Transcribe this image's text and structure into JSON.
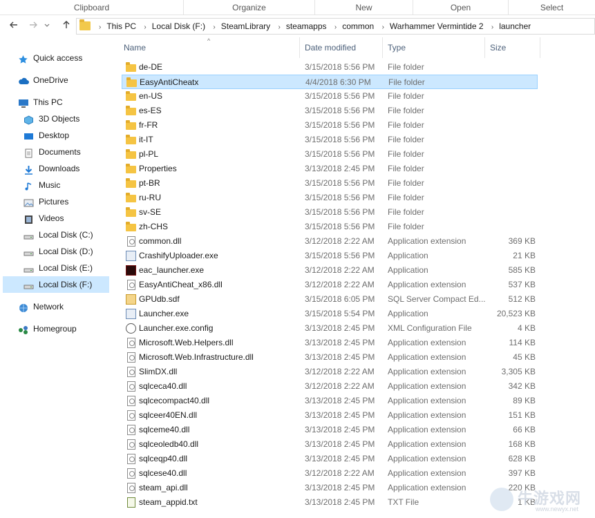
{
  "ribbon": {
    "groups": [
      "Clipboard",
      "Organize",
      "New",
      "Open",
      "Select"
    ]
  },
  "address": {
    "crumbs": [
      "This PC",
      "Local Disk (F:)",
      "SteamLibrary",
      "steamapps",
      "common",
      "Warhammer Vermintide 2",
      "launcher"
    ]
  },
  "nav": {
    "back_icon": "back-arrow-icon",
    "forward_icon": "forward-arrow-icon",
    "recent_icon": "chevron-down-icon",
    "up_icon": "up-arrow-icon"
  },
  "sidebar": {
    "items": [
      {
        "label": "Quick access",
        "icon": "star-icon"
      },
      {
        "label": "OneDrive",
        "icon": "cloud-icon"
      },
      {
        "label": "This PC",
        "icon": "computer-icon"
      },
      {
        "label": "3D Objects",
        "icon": "cube-icon"
      },
      {
        "label": "Desktop",
        "icon": "desktop-icon"
      },
      {
        "label": "Documents",
        "icon": "document-icon"
      },
      {
        "label": "Downloads",
        "icon": "download-icon"
      },
      {
        "label": "Music",
        "icon": "music-icon"
      },
      {
        "label": "Pictures",
        "icon": "picture-icon"
      },
      {
        "label": "Videos",
        "icon": "video-icon"
      },
      {
        "label": "Local Disk (C:)",
        "icon": "drive-icon"
      },
      {
        "label": "Local Disk (D:)",
        "icon": "drive-icon"
      },
      {
        "label": "Local Disk (E:)",
        "icon": "drive-icon"
      },
      {
        "label": "Local Disk (F:)",
        "icon": "drive-icon"
      },
      {
        "label": "Network",
        "icon": "network-icon"
      },
      {
        "label": "Homegroup",
        "icon": "homegroup-icon"
      }
    ],
    "selected": "Local Disk (F:)"
  },
  "columns": {
    "name": "Name",
    "date": "Date modified",
    "type": "Type",
    "size": "Size",
    "sort_indicator": "^"
  },
  "files": [
    {
      "name": "de-DE",
      "date": "3/15/2018 5:56 PM",
      "type": "File folder",
      "size": "",
      "icon": "folder"
    },
    {
      "name": "EasyAntiCheatx",
      "date": "4/4/2018 6:30 PM",
      "type": "File folder",
      "size": "",
      "icon": "folder"
    },
    {
      "name": "en-US",
      "date": "3/15/2018 5:56 PM",
      "type": "File folder",
      "size": "",
      "icon": "folder"
    },
    {
      "name": "es-ES",
      "date": "3/15/2018 5:56 PM",
      "type": "File folder",
      "size": "",
      "icon": "folder"
    },
    {
      "name": "fr-FR",
      "date": "3/15/2018 5:56 PM",
      "type": "File folder",
      "size": "",
      "icon": "folder"
    },
    {
      "name": "it-IT",
      "date": "3/15/2018 5:56 PM",
      "type": "File folder",
      "size": "",
      "icon": "folder"
    },
    {
      "name": "pl-PL",
      "date": "3/15/2018 5:56 PM",
      "type": "File folder",
      "size": "",
      "icon": "folder"
    },
    {
      "name": "Properties",
      "date": "3/13/2018 2:45 PM",
      "type": "File folder",
      "size": "",
      "icon": "folder"
    },
    {
      "name": "pt-BR",
      "date": "3/15/2018 5:56 PM",
      "type": "File folder",
      "size": "",
      "icon": "folder"
    },
    {
      "name": "ru-RU",
      "date": "3/15/2018 5:56 PM",
      "type": "File folder",
      "size": "",
      "icon": "folder"
    },
    {
      "name": "sv-SE",
      "date": "3/15/2018 5:56 PM",
      "type": "File folder",
      "size": "",
      "icon": "folder"
    },
    {
      "name": "zh-CHS",
      "date": "3/15/2018 5:56 PM",
      "type": "File folder",
      "size": "",
      "icon": "folder"
    },
    {
      "name": "common.dll",
      "date": "3/12/2018 2:22 AM",
      "type": "Application extension",
      "size": "369 KB",
      "icon": "dll"
    },
    {
      "name": "CrashifyUploader.exe",
      "date": "3/15/2018 5:56 PM",
      "type": "Application",
      "size": "21 KB",
      "icon": "exe"
    },
    {
      "name": "eac_launcher.exe",
      "date": "3/12/2018 2:22 AM",
      "type": "Application",
      "size": "585 KB",
      "icon": "eac"
    },
    {
      "name": "EasyAntiCheat_x86.dll",
      "date": "3/12/2018 2:22 AM",
      "type": "Application extension",
      "size": "537 KB",
      "icon": "dll"
    },
    {
      "name": "GPUdb.sdf",
      "date": "3/15/2018 6:05 PM",
      "type": "SQL Server Compact Ed...",
      "size": "512 KB",
      "icon": "sdf"
    },
    {
      "name": "Launcher.exe",
      "date": "3/15/2018 5:54 PM",
      "type": "Application",
      "size": "20,523 KB",
      "icon": "exe"
    },
    {
      "name": "Launcher.exe.config",
      "date": "3/13/2018 2:45 PM",
      "type": "XML Configuration File",
      "size": "4 KB",
      "icon": "cfg"
    },
    {
      "name": "Microsoft.Web.Helpers.dll",
      "date": "3/13/2018 2:45 PM",
      "type": "Application extension",
      "size": "114 KB",
      "icon": "dll"
    },
    {
      "name": "Microsoft.Web.Infrastructure.dll",
      "date": "3/13/2018 2:45 PM",
      "type": "Application extension",
      "size": "45 KB",
      "icon": "dll"
    },
    {
      "name": "SlimDX.dll",
      "date": "3/12/2018 2:22 AM",
      "type": "Application extension",
      "size": "3,305 KB",
      "icon": "dll"
    },
    {
      "name": "sqlceca40.dll",
      "date": "3/12/2018 2:22 AM",
      "type": "Application extension",
      "size": "342 KB",
      "icon": "dll"
    },
    {
      "name": "sqlcecompact40.dll",
      "date": "3/13/2018 2:45 PM",
      "type": "Application extension",
      "size": "89 KB",
      "icon": "dll"
    },
    {
      "name": "sqlceer40EN.dll",
      "date": "3/13/2018 2:45 PM",
      "type": "Application extension",
      "size": "151 KB",
      "icon": "dll"
    },
    {
      "name": "sqlceme40.dll",
      "date": "3/13/2018 2:45 PM",
      "type": "Application extension",
      "size": "66 KB",
      "icon": "dll"
    },
    {
      "name": "sqlceoledb40.dll",
      "date": "3/13/2018 2:45 PM",
      "type": "Application extension",
      "size": "168 KB",
      "icon": "dll"
    },
    {
      "name": "sqlceqp40.dll",
      "date": "3/13/2018 2:45 PM",
      "type": "Application extension",
      "size": "628 KB",
      "icon": "dll"
    },
    {
      "name": "sqlcese40.dll",
      "date": "3/12/2018 2:22 AM",
      "type": "Application extension",
      "size": "397 KB",
      "icon": "dll"
    },
    {
      "name": "steam_api.dll",
      "date": "3/13/2018 2:45 PM",
      "type": "Application extension",
      "size": "220 KB",
      "icon": "dll"
    },
    {
      "name": "steam_appid.txt",
      "date": "3/13/2018 2:45 PM",
      "type": "TXT File",
      "size": "1 KB",
      "icon": "txt"
    }
  ],
  "selected_file": "EasyAntiCheatx",
  "watermark": {
    "text": "牛游戏网",
    "url": "www.newyx.net"
  },
  "colors": {
    "selection_bg": "#cce8ff",
    "selection_border": "#99d1ff",
    "header_text": "#4c607a",
    "folder": "#f5c443"
  }
}
